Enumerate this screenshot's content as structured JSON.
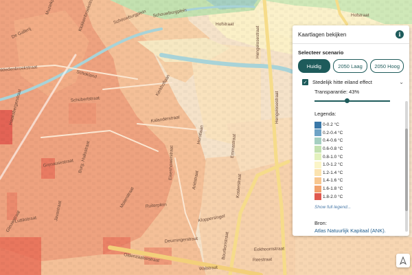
{
  "panel": {
    "title": "Kaartlagen bekijken",
    "info_icon": "i",
    "scenario_label": "Selecteer scenario",
    "scenarios": [
      {
        "label": "Huidig",
        "active": true
      },
      {
        "label": "2050 Laag",
        "active": false
      },
      {
        "label": "2050 Hoog",
        "active": false
      }
    ],
    "layer": {
      "label": "Stedelijk hitte eiland effect",
      "checked": true,
      "checkmark": "✓",
      "chevron": "⌄"
    },
    "transparency": {
      "label": "Transparantie: 43%",
      "value": 0.43
    },
    "legend_title": "Legenda:",
    "legend": [
      {
        "label": "0-0.2 °C",
        "color": "#3a78a8"
      },
      {
        "label": "0.2-0.4 °C",
        "color": "#6ea3c6"
      },
      {
        "label": "0.4-0.6 °C",
        "color": "#a5cfc1"
      },
      {
        "label": "0.6-0.8 °C",
        "color": "#c3e1b0"
      },
      {
        "label": "0.8-1.0 °C",
        "color": "#e3f2bd"
      },
      {
        "label": "1.0-1.2 °C",
        "color": "#fbf5c8"
      },
      {
        "label": "1.2-1.4 °C",
        "color": "#fbe3b0"
      },
      {
        "label": "1.4-1.6 °C",
        "color": "#f8c790"
      },
      {
        "label": "1.6-1.8 °C",
        "color": "#f2a26d"
      },
      {
        "label": "1.8-2.0 °C",
        "color": "#e0584e"
      }
    ],
    "show_full": "Show full legend...",
    "source_label": "Bron:",
    "source_link": "Atlas Natuurlijk Kapitaal (ANK)."
  },
  "north_icon": "north-arrow",
  "streets": [
    "De Gallerij",
    "Wiedenbroekstraat",
    "Klokkenbroekstraat",
    "Schokland",
    "Muziekplein",
    "Schouwburgplein",
    "Schouwburgplein",
    "Schubertstraat",
    "Hofstraat",
    "Hofstraat",
    "Hengelosestraat",
    "Kalanderstraat",
    "Kerkhoflaan",
    "Horstlaan",
    "Emmastraat",
    "Eisenhowerstraat",
    "Burg. Huilsstraat",
    "Hengelosestraat",
    "Gronausestraat",
    "Molenstraat",
    "Javastraat",
    "Ariëstraat",
    "Haaksbergerstraat",
    "Luttikstraat",
    "Deurningerstraat",
    "Ruiterplein",
    "Kloppersingel",
    "Walstraat",
    "Oldenzaalsestraat",
    "Bourbonstraat",
    "Reestraat",
    "Eekhoornstraat",
    "Kosterstraat",
    "Gleuwstraat"
  ]
}
